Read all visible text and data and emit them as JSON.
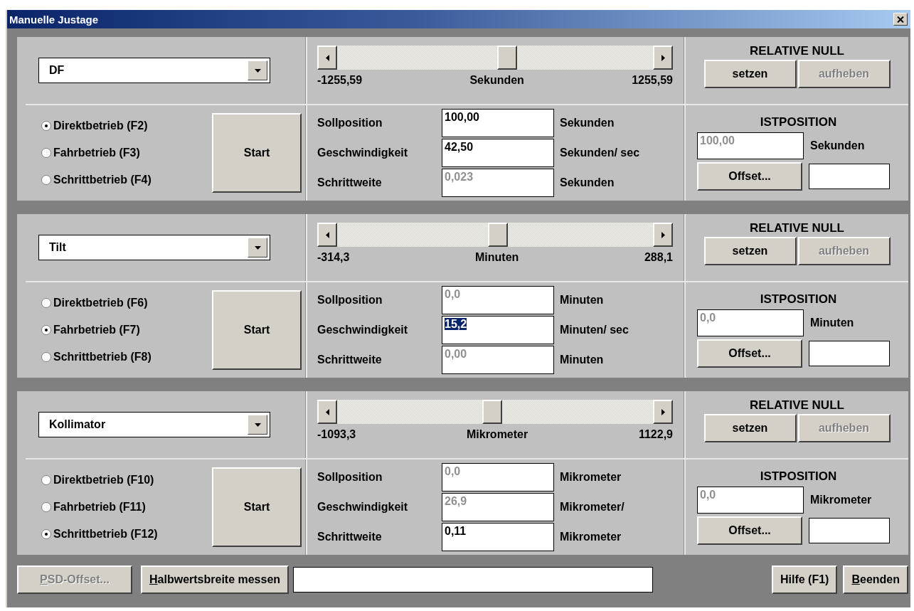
{
  "window": {
    "title": "Manuelle Justage"
  },
  "axes": [
    {
      "axis": "DF",
      "slider": {
        "level": 0.54,
        "min": "-1255,59",
        "unit": "Sekunden",
        "max": "1255,59"
      },
      "relative_null": {
        "heading": "RELATIVE NULL",
        "buttons": [
          {
            "label": "setzen",
            "disabled": false
          },
          {
            "label": "aufheben",
            "disabled": true
          }
        ]
      },
      "modes": [
        {
          "label": "Direktbetrieb (F2)",
          "selected": true
        },
        {
          "label": "Fahrbetrieb (F3)",
          "selected": false
        },
        {
          "label": "Schrittbetrieb (F4)",
          "selected": false
        }
      ],
      "start": "Start",
      "params": [
        {
          "label": "Sollposition",
          "value": "100,00",
          "disabled": false,
          "selected": false,
          "unit": "Sekunden"
        },
        {
          "label": "Geschwindigkeit",
          "value": "42,50",
          "disabled": false,
          "selected": false,
          "unit": "Sekunden/ sec"
        },
        {
          "label": "Schrittweite",
          "value": "0,023",
          "disabled": true,
          "selected": false,
          "unit": "Sekunden"
        }
      ],
      "istposition": {
        "heading": "ISTPOSITION",
        "value": "100,00",
        "unit": "Sekunden",
        "offset_button": "Offset..."
      }
    },
    {
      "axis": "Tilt",
      "slider": {
        "level": 0.51,
        "min": "-314,3",
        "unit": "Minuten",
        "max": "288,1"
      },
      "relative_null": {
        "heading": "RELATIVE NULL",
        "buttons": [
          {
            "label": "setzen",
            "disabled": false
          },
          {
            "label": "aufheben",
            "disabled": true
          }
        ]
      },
      "modes": [
        {
          "label": "Direktbetrieb (F6)",
          "selected": false
        },
        {
          "label": "Fahrbetrieb (F7)",
          "selected": true
        },
        {
          "label": "Schrittbetrieb (F8)",
          "selected": false
        }
      ],
      "start": "Start",
      "params": [
        {
          "label": "Sollposition",
          "value": "0,0",
          "disabled": true,
          "selected": false,
          "unit": "Minuten"
        },
        {
          "label": "Geschwindigkeit",
          "value": "15,2",
          "disabled": false,
          "selected": true,
          "unit": "Minuten/ sec"
        },
        {
          "label": "Schrittweite",
          "value": "0,00",
          "disabled": true,
          "selected": false,
          "unit": "Minuten"
        }
      ],
      "istposition": {
        "heading": "ISTPOSITION",
        "value": "0,0",
        "unit": "Minuten",
        "offset_button": "Offset..."
      }
    },
    {
      "axis": "Kollimator",
      "slider": {
        "level": 0.49,
        "min": "-1093,3",
        "unit": "Mikrometer",
        "max": "1122,9"
      },
      "relative_null": {
        "heading": "RELATIVE NULL",
        "buttons": [
          {
            "label": "setzen",
            "disabled": false
          },
          {
            "label": "aufheben",
            "disabled": true
          }
        ]
      },
      "modes": [
        {
          "label": "Direktbetrieb (F10)",
          "selected": false
        },
        {
          "label": "Fahrbetrieb (F11)",
          "selected": false
        },
        {
          "label": "Schrittbetrieb (F12)",
          "selected": true
        }
      ],
      "start": "Start",
      "params": [
        {
          "label": "Sollposition",
          "value": "0,0",
          "disabled": true,
          "selected": false,
          "unit": "Mikrometer"
        },
        {
          "label": "Geschwindigkeit",
          "value": "26,9",
          "disabled": true,
          "selected": false,
          "unit": "Mikrometer/"
        },
        {
          "label": "Schrittweite",
          "value": "0,11",
          "disabled": false,
          "selected": false,
          "unit": "Mikrometer"
        }
      ],
      "istposition": {
        "heading": "ISTPOSITION",
        "value": "0,0",
        "unit": "Mikrometer",
        "offset_button": "Offset..."
      }
    }
  ],
  "footer": {
    "left_buttons": [
      {
        "label": "PSD-Offset...",
        "disabled": true,
        "underline_first": true
      },
      {
        "label": "Halbwertsbreite messen",
        "disabled": false,
        "underline_first": true
      }
    ],
    "right_buttons": [
      {
        "label": "Hilfe (F1)",
        "disabled": false,
        "underline_first": false
      },
      {
        "label": "Beenden",
        "disabled": false,
        "underline_first": true
      }
    ]
  }
}
